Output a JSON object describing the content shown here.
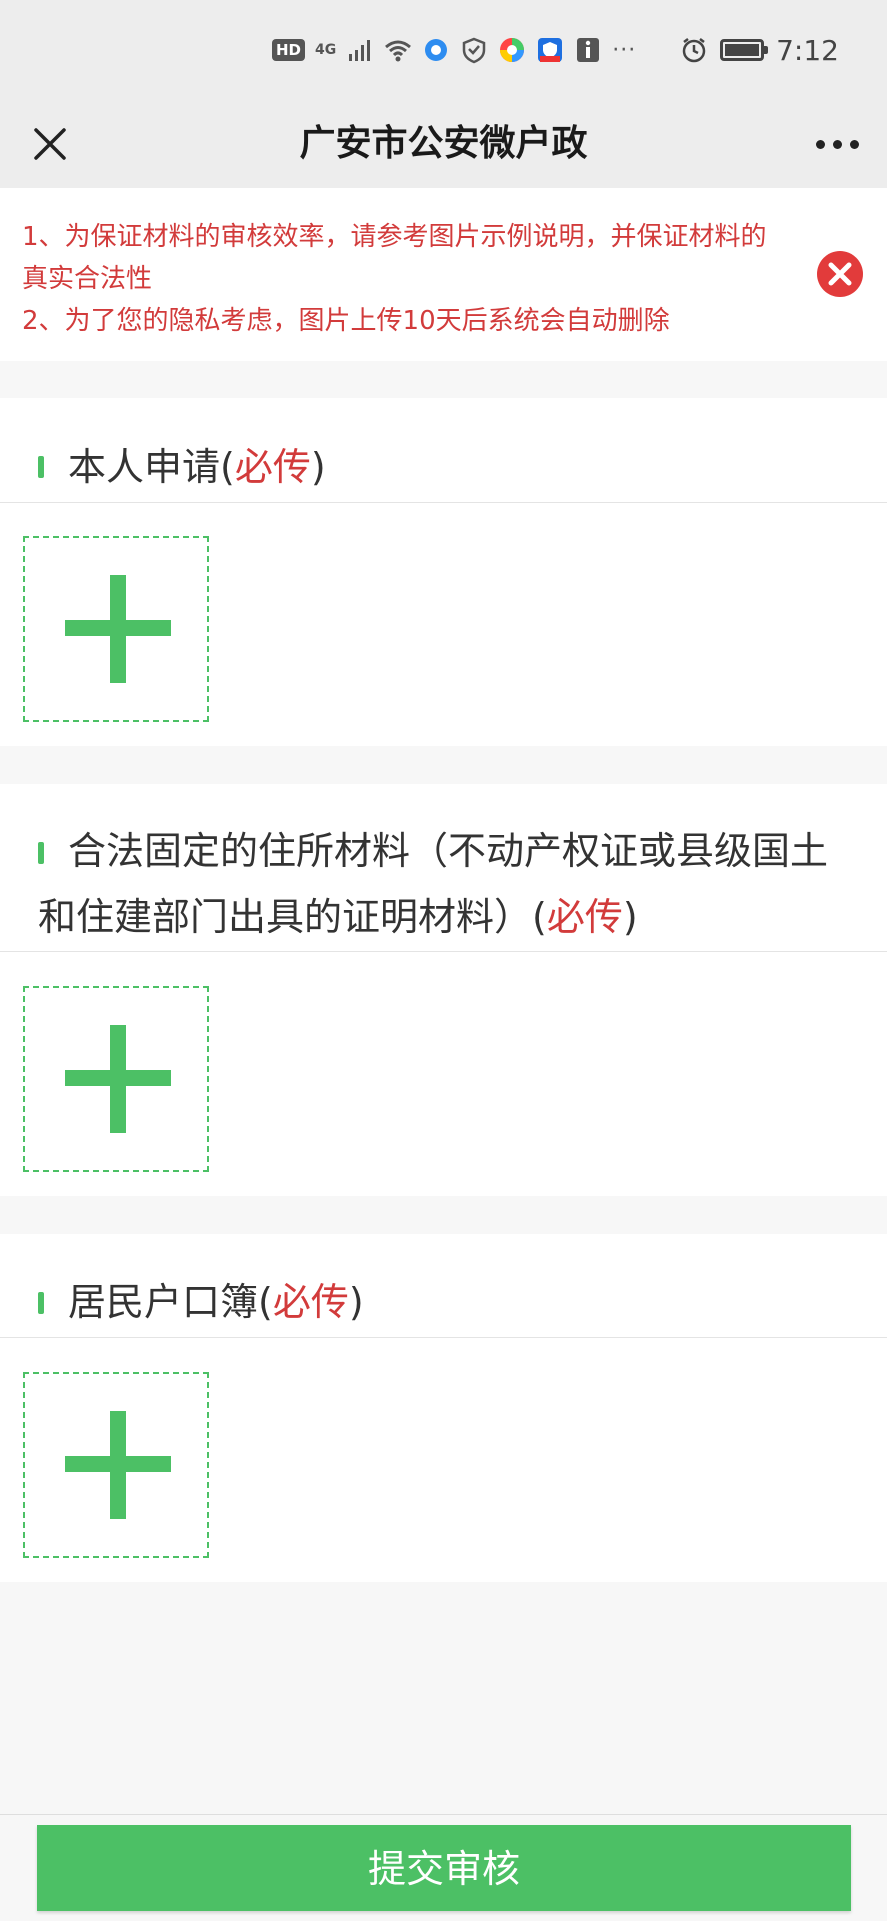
{
  "status_bar": {
    "hd": "HD",
    "network": "4G",
    "more": "···",
    "time": "7:12"
  },
  "nav": {
    "title": "广安市公安微户政",
    "close_icon": "close-icon",
    "more_icon": "more-dots-icon"
  },
  "notice": {
    "lines": [
      "1、为保证材料的审核效率，请参考图片示例说明，并保证材料的真实合法性",
      "2、为了您的隐私考虑，图片上传10天后系统会自动删除"
    ]
  },
  "sections": [
    {
      "title": "本人申请",
      "paren_open": "(",
      "required": "必传",
      "paren_close": ")"
    },
    {
      "title": "合法固定的住所材料（不动产权证或县级国土和住建部门出具的证明材料）",
      "paren_open": "(",
      "required": "必传",
      "paren_close": ")"
    },
    {
      "title": "居民户口簿",
      "paren_open": "(",
      "required": "必传",
      "paren_close": ")"
    }
  ],
  "submit_label": "提交审核",
  "colors": {
    "accent_green": "#4cc065",
    "warning_red": "#d23b3b"
  }
}
